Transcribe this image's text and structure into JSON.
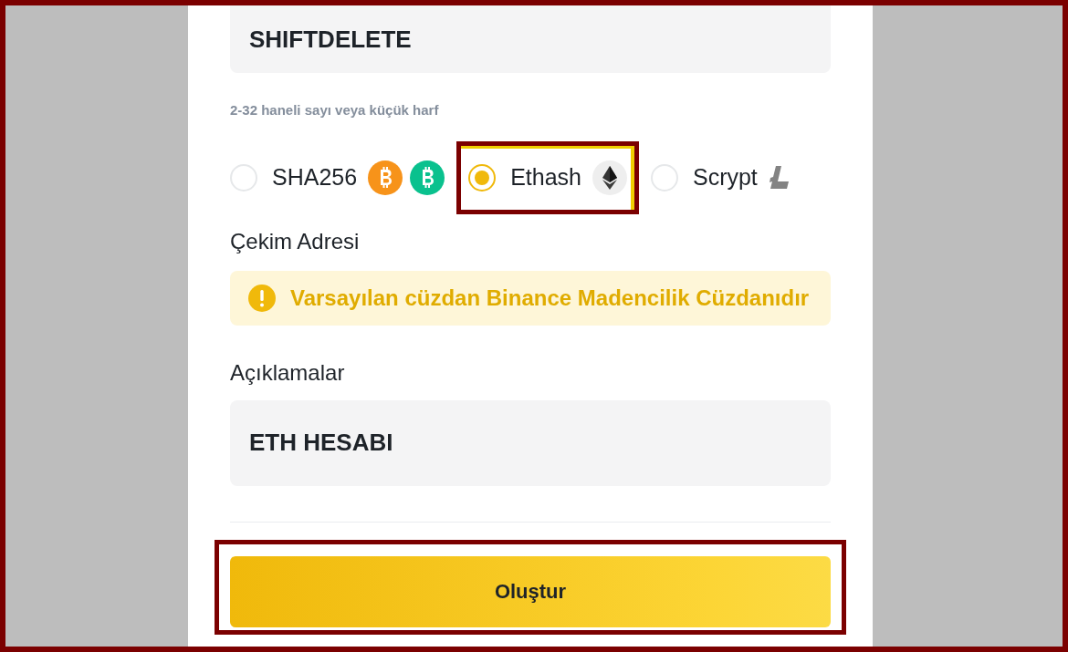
{
  "name_field": {
    "value": "SHIFTDELETE"
  },
  "name_hint": "2-32 haneli sayı veya küçük harf",
  "algorithms": [
    {
      "label": "SHA256",
      "selected": false,
      "highlighted": false,
      "coins": [
        {
          "kind": "btc"
        },
        {
          "kind": "bch"
        }
      ]
    },
    {
      "label": "Ethash",
      "selected": true,
      "highlighted": true,
      "coins": [
        {
          "kind": "eth"
        }
      ]
    },
    {
      "label": "Scrypt",
      "selected": false,
      "highlighted": false,
      "coins": [
        {
          "kind": "ltc"
        }
      ]
    }
  ],
  "withdraw_label": "Çekim Adresi",
  "notice": "Varsayılan cüzdan Binance Madencilik Cüzdanıdır",
  "remarks_label": "Açıklamalar",
  "remarks_field": {
    "value": "ETH HESABI"
  },
  "submit": {
    "label": "Oluştur",
    "highlighted": true
  }
}
